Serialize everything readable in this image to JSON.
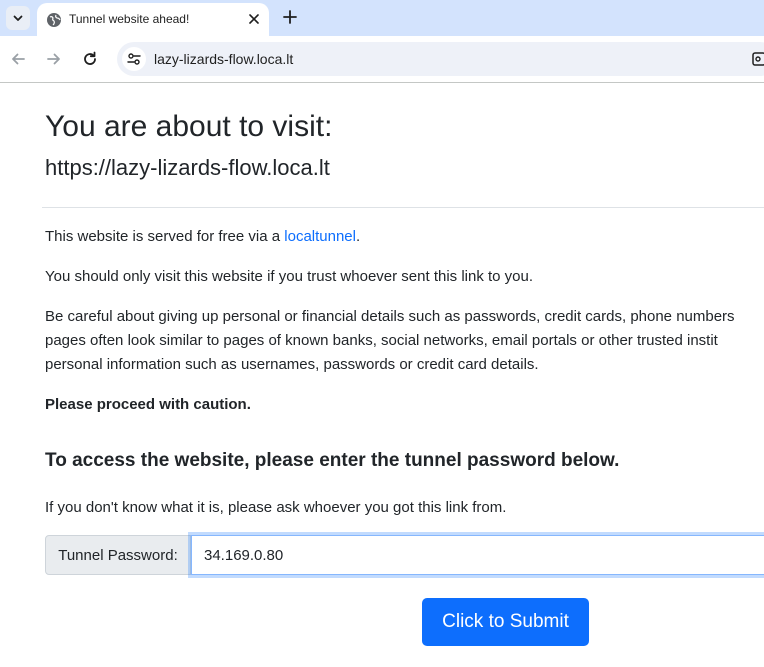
{
  "browser": {
    "tab": {
      "title": "Tunnel website ahead!"
    },
    "url": "lazy-lizards-flow.loca.lt"
  },
  "page": {
    "heading": "You are about to visit:",
    "visit_url": "https://lazy-lizards-flow.loca.lt",
    "served_prefix": "This website is served for free via a ",
    "served_link": "localtunnel",
    "served_suffix": ".",
    "trust_text": "You should only visit this website if you trust whoever sent this link to you.",
    "careful_line1": "Be careful about giving up personal or financial details such as passwords, credit cards, phone numbers",
    "careful_line2": "pages often look similar to pages of known banks, social networks, email portals or other trusted instit",
    "careful_line3": "personal information such as usernames, passwords or credit card details.",
    "caution": "Please proceed with caution.",
    "access_heading": "To access the website, please enter the tunnel password below.",
    "ask_text": "If you don't know what it is, please ask whoever you got this link from.",
    "password_label": "Tunnel Password:",
    "password_value": "34.169.0.80",
    "submit_label": "Click to Submit"
  },
  "colors": {
    "link": "#0d6efd",
    "button": "#0d6efd",
    "tabstrip": "#d3e3fd"
  }
}
